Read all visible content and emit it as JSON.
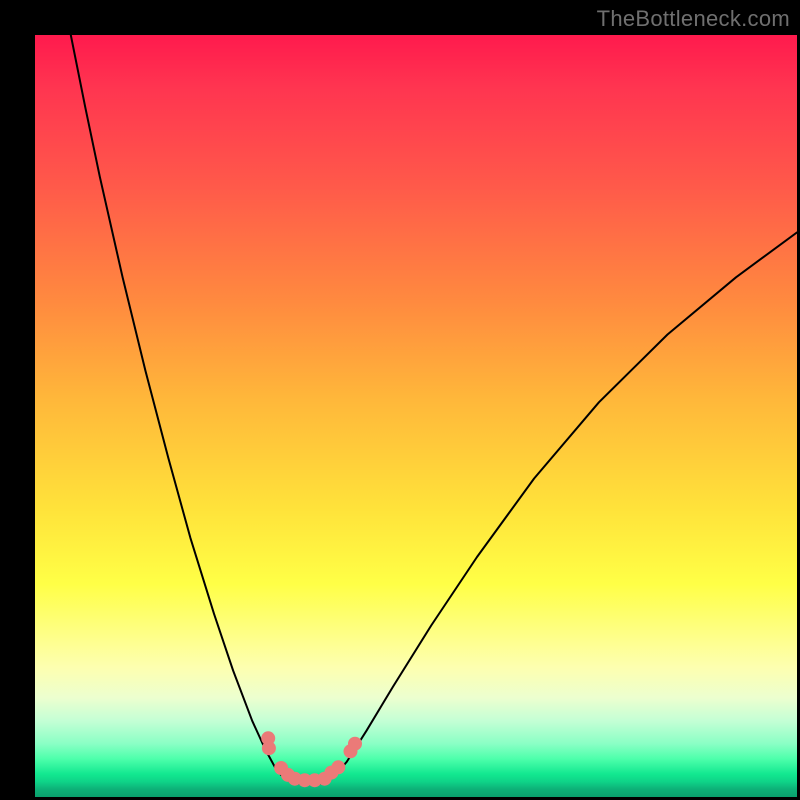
{
  "attribution": "TheBottleneck.com",
  "colors": {
    "marker": "#eb7a78",
    "curve": "#000000"
  },
  "chart_data": {
    "type": "line",
    "title": "",
    "xlabel": "",
    "ylabel": "",
    "xlim": [
      0,
      100
    ],
    "ylim": [
      0,
      100
    ],
    "note": "Axes are unlabeled in source; x is an arbitrary horizontal parameter (0–100), y is bottleneck severity percent where 0 is bottom (green/good) and 100 is top (red/bad). Values estimated from pixel positions.",
    "series": [
      {
        "name": "left-branch",
        "x": [
          4.7,
          6.6,
          8.5,
          11.5,
          14.5,
          17.5,
          20.4,
          23.5,
          26.0,
          28.5,
          30.2,
          31.5,
          32.2,
          33.1,
          34.1
        ],
        "y": [
          100.0,
          90.5,
          81.4,
          68.2,
          55.9,
          44.5,
          34.0,
          24.0,
          16.6,
          10.0,
          6.3,
          3.9,
          3.0,
          2.2,
          1.8
        ]
      },
      {
        "name": "valley-floor",
        "x": [
          34.1,
          35.4,
          36.7,
          38.0
        ],
        "y": [
          1.8,
          1.7,
          1.7,
          1.8
        ]
      },
      {
        "name": "right-branch",
        "x": [
          38.0,
          39.3,
          40.9,
          43.5,
          47.0,
          52.0,
          58.0,
          65.5,
          74.0,
          83.0,
          92.0,
          100.0
        ],
        "y": [
          1.8,
          2.8,
          4.6,
          8.7,
          14.5,
          22.5,
          31.5,
          41.8,
          51.8,
          60.7,
          68.2,
          74.1
        ]
      }
    ],
    "markers": {
      "name": "highlighted-points",
      "x": [
        30.6,
        30.7,
        32.3,
        33.2,
        34.1,
        35.4,
        36.7,
        38.0,
        38.9,
        39.8,
        41.4,
        42.0
      ],
      "y": [
        7.7,
        6.4,
        3.8,
        2.9,
        2.4,
        2.2,
        2.2,
        2.4,
        3.2,
        3.9,
        6.0,
        7.0
      ],
      "radius_px": 7
    },
    "background": {
      "type": "vertical-gradient",
      "stops": [
        {
          "pos": 0.0,
          "color": "#ff1a4d"
        },
        {
          "pos": 0.5,
          "color": "#ffd23a"
        },
        {
          "pos": 0.75,
          "color": "#feff6a"
        },
        {
          "pos": 0.92,
          "color": "#8affc5"
        },
        {
          "pos": 1.0,
          "color": "#0aa06d"
        }
      ]
    }
  }
}
